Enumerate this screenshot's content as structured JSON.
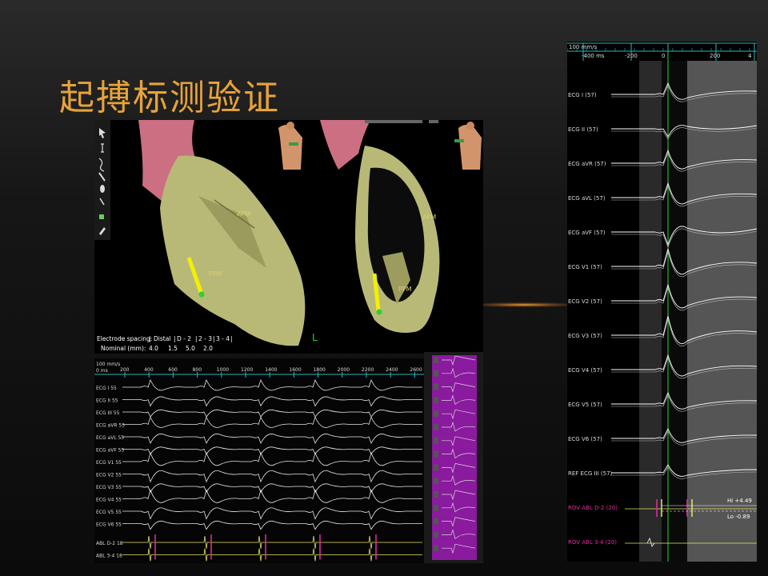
{
  "slide": {
    "title": "起搏标测验证",
    "accent": "#e8a33a"
  },
  "map3d": {
    "spacing_label": "Electrode spacing:",
    "spacing_cols": [
      "Distal",
      "D - 2",
      "2 - 3",
      "3 - 4"
    ],
    "nominal_label": "Nominal (mm):",
    "nominal_values": [
      "4.0",
      "1.5",
      "5.0",
      "2.0"
    ],
    "left_labels": {
      "apm": "APM",
      "ppm": "PPM"
    },
    "right_labels": {
      "apm": "APM",
      "ppm": "PPM"
    },
    "orientation_marker": "L",
    "toolbar_icons": [
      "pointer-icon",
      "cursor-icon",
      "text-cursor-icon",
      "curve-icon",
      "line-icon",
      "ellipse-icon",
      "catheter-icon",
      "grid-icon",
      "paint-icon"
    ]
  },
  "ecg_bottom": {
    "speed": "100 mm/s",
    "origin": "0 ms",
    "ticks": [
      "200",
      "400",
      "600",
      "800",
      "1000",
      "1200",
      "1400",
      "1600",
      "1800",
      "2000",
      "2200",
      "2400",
      "2600"
    ],
    "leads": [
      "ECG I 55",
      "ECG II 55",
      "ECG III 55",
      "ECG aVR 55",
      "ECG aVL 55",
      "ECG aVF 55",
      "ECG V1 55",
      "ECG V2 55",
      "ECG V3 55",
      "ECG V4 55",
      "ECG V5 55",
      "ECG V6 55",
      "ABL D-2 18",
      "ABL 3-4 18"
    ]
  },
  "ecg_right": {
    "speed": "100 mm/s",
    "ticks": [
      "-400 ms",
      "-200",
      "0",
      "200",
      "4"
    ],
    "leads": [
      "ECG I (57)",
      "ECG II (57)",
      "ECG aVR (57)",
      "ECG aVL (57)",
      "ECG aVF (57)",
      "ECG V1 (57)",
      "ECG V2 (57)",
      "ECG V3 (57)",
      "ECG V4 (57)",
      "ECG V5 (57)",
      "ECG V6 (57)",
      "REF ECG III (57)"
    ],
    "abl_leads": [
      "ROV ABL  D-2 (20)",
      "ROV ABL  3-4 (20)"
    ],
    "hi_label": "Hi +4.49",
    "lo_label": "Lo -0.89"
  }
}
